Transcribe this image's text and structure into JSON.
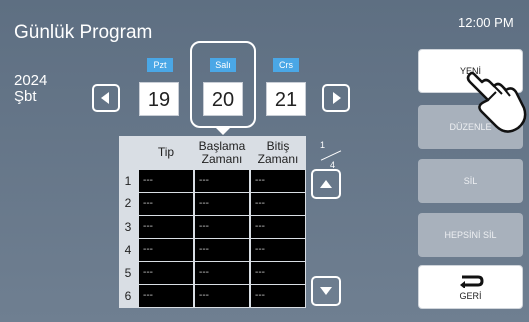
{
  "header": {
    "title": "Günlük Program",
    "time": "12:00 PM"
  },
  "year": {
    "line1": "2024",
    "line2": "Şbt"
  },
  "days": [
    {
      "name": "Pzt",
      "num": "19"
    },
    {
      "name": "Salı",
      "num": "20"
    },
    {
      "name": "Crs",
      "num": "21"
    }
  ],
  "table": {
    "headers": [
      "Tip",
      "Başlama Zamanı",
      "Bitiş Zamanı"
    ],
    "rows": [
      {
        "n": "1",
        "cells": [
          "---",
          "---",
          "---"
        ]
      },
      {
        "n": "2",
        "cells": [
          "---",
          "---",
          "---"
        ]
      },
      {
        "n": "3",
        "cells": [
          "---",
          "---",
          "---"
        ]
      },
      {
        "n": "4",
        "cells": [
          "---",
          "---",
          "---"
        ]
      },
      {
        "n": "5",
        "cells": [
          "---",
          "---",
          "---"
        ]
      },
      {
        "n": "6",
        "cells": [
          "---",
          "---",
          "---"
        ]
      }
    ]
  },
  "page": {
    "current": "1",
    "total": "4"
  },
  "side": {
    "new": "YENİ",
    "edit": "DÜZENLE",
    "delete": "SİL",
    "delete_all": "HEPSİNİ SİL",
    "back": "GERİ"
  },
  "colors": {
    "tab": "#4aa7e6",
    "screen": "#667789",
    "disabled": "#a8b1bc"
  },
  "icons": [
    "left-arrow-icon",
    "right-arrow-icon",
    "up-arrow-icon",
    "down-arrow-icon",
    "back-icon",
    "pointing-hand-icon"
  ]
}
